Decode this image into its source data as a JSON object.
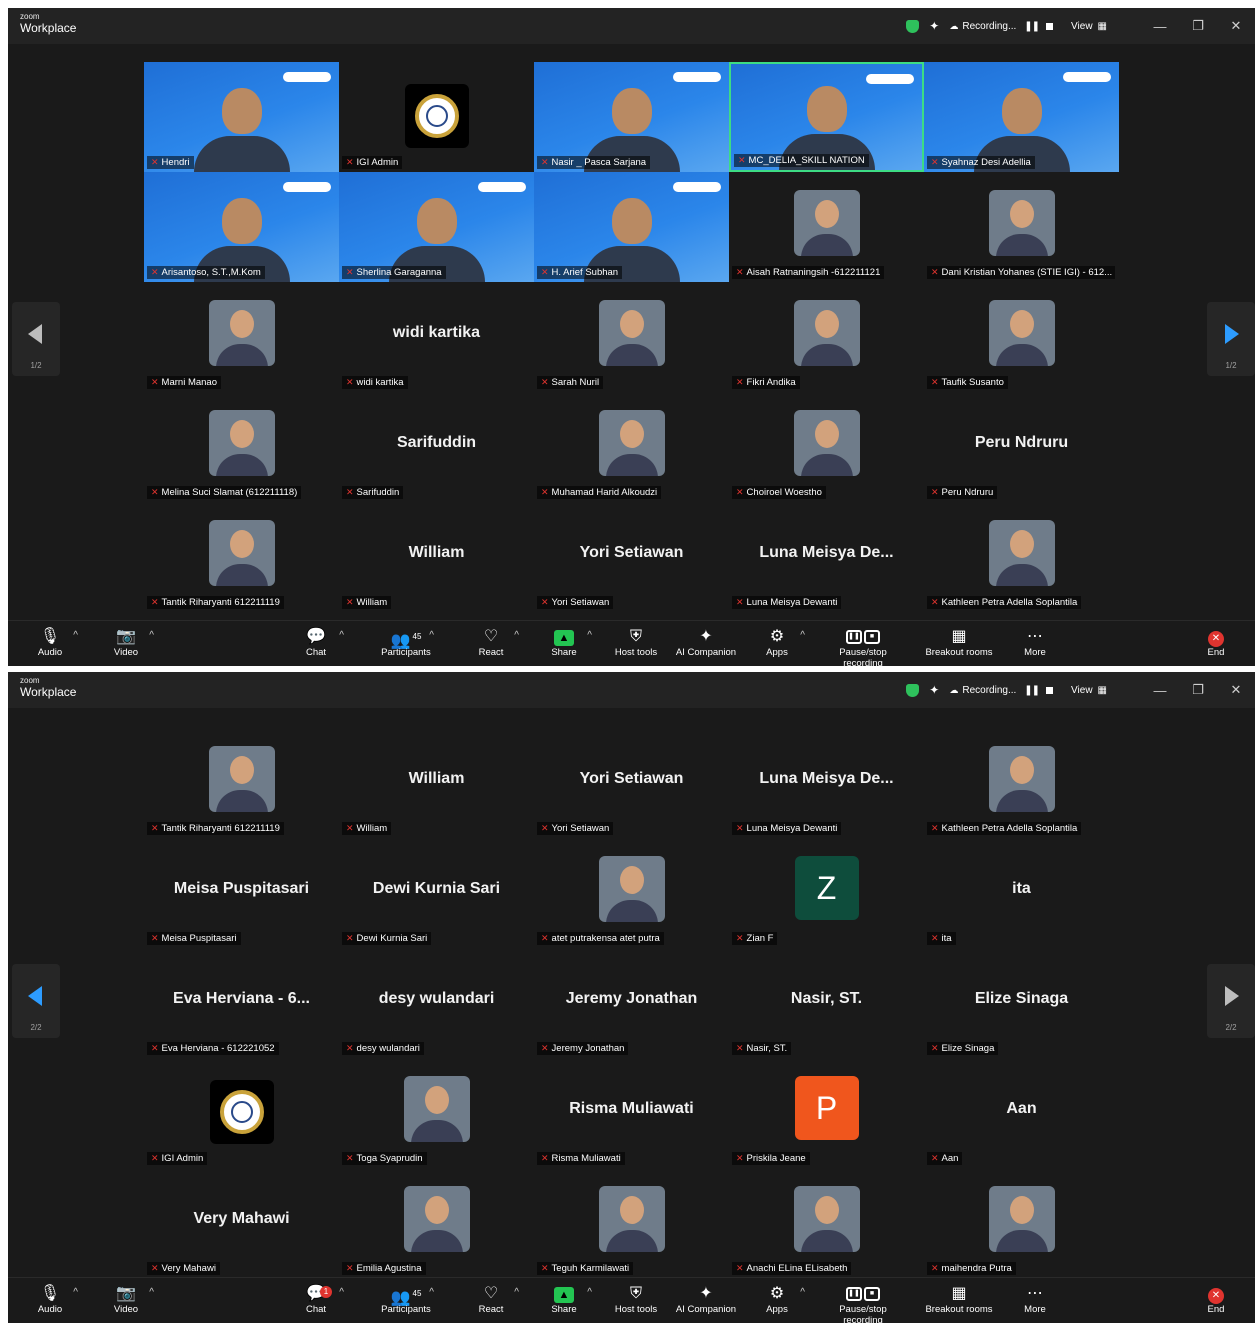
{
  "brand": {
    "small": "zoom",
    "name": "Workplace"
  },
  "titlebar": {
    "recording_label": "Recording...",
    "view_label": "View",
    "minimize": "—",
    "restore": "❐",
    "close": "✕"
  },
  "colors": {
    "accent": "#2d9cff",
    "muted_red": "#e0342f",
    "share_green": "#23c552",
    "active_border": "#3ddc84",
    "tile_bg": "#232323"
  },
  "toolbar": {
    "audio": "Audio",
    "video": "Video",
    "chat": "Chat",
    "participants": "Participants",
    "participants_count": "45",
    "react": "React",
    "share": "Share",
    "host_tools": "Host tools",
    "ai_companion": "AI Companion",
    "apps": "Apps",
    "pause_stop_recording": "Pause/stop recording",
    "breakout_rooms": "Breakout rooms",
    "more": "More",
    "end": "End",
    "chat_badge": "1"
  },
  "page1": {
    "pager_left": "1/2",
    "pager_right": "1/2",
    "tiles": [
      {
        "label": "Hendri",
        "kind": "video"
      },
      {
        "label": "IGI Admin",
        "kind": "seal"
      },
      {
        "label": "Nasir _ Pasca Sarjana",
        "kind": "video"
      },
      {
        "label": "MC_DELIA_SKILL NATION",
        "kind": "video",
        "active": true
      },
      {
        "label": "Syahnaz Desi Adellia",
        "kind": "video"
      },
      {
        "label": "Arisantoso, S.T.,M.Kom",
        "kind": "video"
      },
      {
        "label": "Sherlina Garaganna",
        "kind": "video"
      },
      {
        "label": "H. Arief Subhan",
        "kind": "video"
      },
      {
        "label": "Aisah Ratnaningsih -612211121",
        "kind": "photo"
      },
      {
        "label": "Dani Kristian Yohanes (STIE IGI) - 612...",
        "kind": "photo"
      },
      {
        "label": "Marni Manao",
        "kind": "photo"
      },
      {
        "label": "widi kartika",
        "kind": "name",
        "big": "widi kartika"
      },
      {
        "label": "Sarah Nuril",
        "kind": "photo"
      },
      {
        "label": "Fikri Andika",
        "kind": "photo"
      },
      {
        "label": "Taufik Susanto",
        "kind": "photo"
      },
      {
        "label": "Melina Suci Slamat (612211118)",
        "kind": "photo"
      },
      {
        "label": "Sarifuddin",
        "kind": "name",
        "big": "Sarifuddin"
      },
      {
        "label": "Muhamad Harid Alkoudzi",
        "kind": "photo"
      },
      {
        "label": "Choiroel Woestho",
        "kind": "photo"
      },
      {
        "label": "Peru Ndruru",
        "kind": "name",
        "big": "Peru Ndruru"
      },
      {
        "label": "Tantik Riharyanti 612211119",
        "kind": "photo"
      },
      {
        "label": "William",
        "kind": "name",
        "big": "William"
      },
      {
        "label": "Yori Setiawan",
        "kind": "name",
        "big": "Yori Setiawan"
      },
      {
        "label": "Luna Meisya Dewanti",
        "kind": "name",
        "big": "Luna Meisya De..."
      },
      {
        "label": "Kathleen Petra Adella Soplantila",
        "kind": "photo"
      }
    ]
  },
  "page2": {
    "pager_left": "2/2",
    "pager_right": "2/2",
    "tiles": [
      {
        "label": "Tantik Riharyanti 612211119",
        "kind": "photo"
      },
      {
        "label": "William",
        "kind": "name",
        "big": "William"
      },
      {
        "label": "Yori Setiawan",
        "kind": "name",
        "big": "Yori Setiawan"
      },
      {
        "label": "Luna Meisya Dewanti",
        "kind": "name",
        "big": "Luna Meisya De..."
      },
      {
        "label": "Kathleen Petra Adella Soplantila",
        "kind": "photo"
      },
      {
        "label": "Meisa Puspitasari",
        "kind": "name",
        "big": "Meisa Puspitasari"
      },
      {
        "label": "Dewi Kurnia Sari",
        "kind": "name",
        "big": "Dewi Kurnia Sari"
      },
      {
        "label": "atet putrakensa atet putra",
        "kind": "photo"
      },
      {
        "label": "Zian F",
        "kind": "letter",
        "letter": "Z",
        "color": "#0e4d3c"
      },
      {
        "label": "ita",
        "kind": "name",
        "big": "ita"
      },
      {
        "label": "Eva Herviana - 612221052",
        "kind": "name",
        "big": "Eva Herviana - 6..."
      },
      {
        "label": "desy wulandari",
        "kind": "name",
        "big": "desy wulandari"
      },
      {
        "label": "Jeremy Jonathan",
        "kind": "name",
        "big": "Jeremy Jonathan"
      },
      {
        "label": "Nasir, ST.",
        "kind": "name",
        "big": "Nasir, ST."
      },
      {
        "label": "Elize Sinaga",
        "kind": "name",
        "big": "Elize Sinaga"
      },
      {
        "label": "IGI Admin",
        "kind": "seal"
      },
      {
        "label": "Toga Syaprudin",
        "kind": "photo"
      },
      {
        "label": "Risma Muliawati",
        "kind": "name",
        "big": "Risma Muliawati"
      },
      {
        "label": "Priskila Jeane",
        "kind": "letter",
        "letter": "P",
        "color": "#f0561d"
      },
      {
        "label": "Aan",
        "kind": "name",
        "big": "Aan"
      },
      {
        "label": "Very Mahawi",
        "kind": "name",
        "big": "Very Mahawi"
      },
      {
        "label": "Emilia Agustina",
        "kind": "photo"
      },
      {
        "label": "Teguh Karmilawati",
        "kind": "photo"
      },
      {
        "label": "Anachi ELina ELisabeth",
        "kind": "photo"
      },
      {
        "label": "maihendra Putra",
        "kind": "photo"
      }
    ]
  }
}
